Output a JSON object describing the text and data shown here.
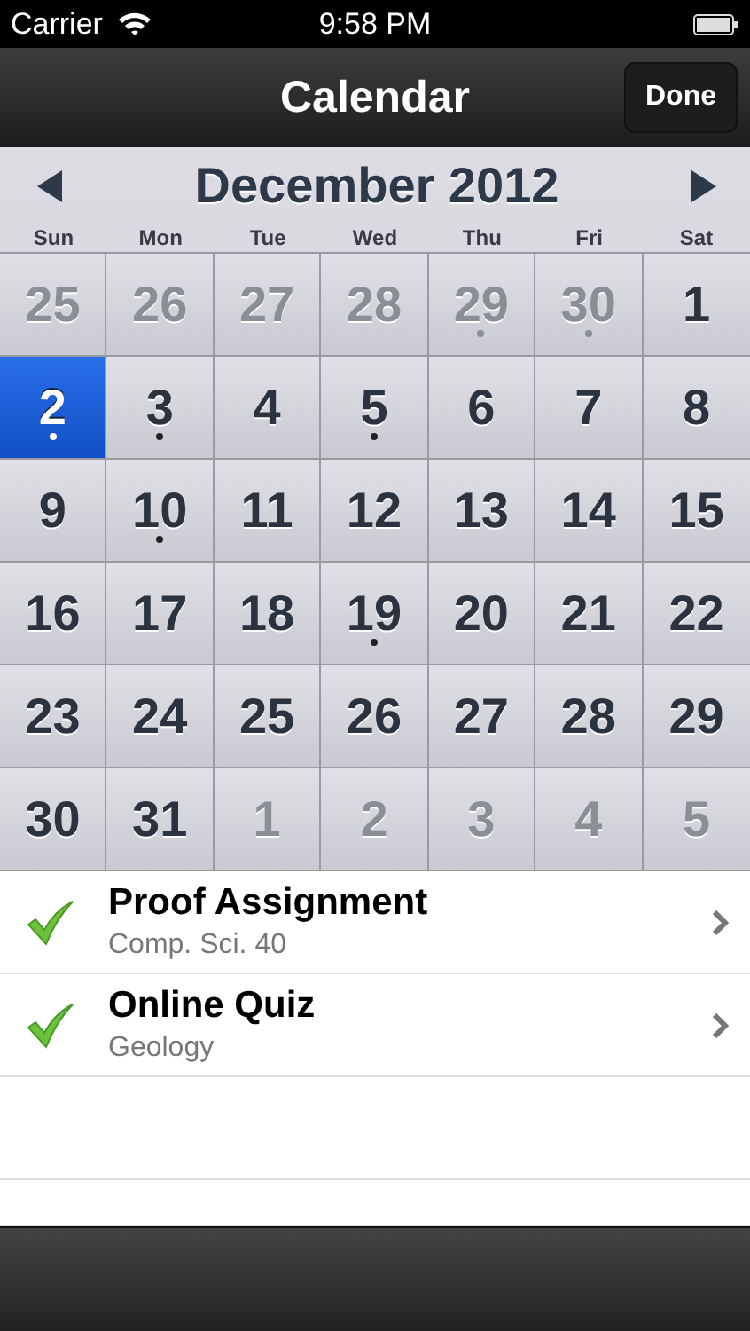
{
  "status_bar": {
    "carrier": "Carrier",
    "time": "9:58 PM"
  },
  "nav_bar": {
    "title": "Calendar",
    "done_button": "Done"
  },
  "calendar": {
    "month": "December 2012",
    "weekdays": [
      "Sun",
      "Mon",
      "Tue",
      "Wed",
      "Thu",
      "Fri",
      "Sat"
    ],
    "days": [
      {
        "day": "25",
        "in_month": false,
        "has_event": false,
        "selected": false
      },
      {
        "day": "26",
        "in_month": false,
        "has_event": false,
        "selected": false
      },
      {
        "day": "27",
        "in_month": false,
        "has_event": false,
        "selected": false
      },
      {
        "day": "28",
        "in_month": false,
        "has_event": false,
        "selected": false
      },
      {
        "day": "29",
        "in_month": false,
        "has_event": true,
        "selected": false
      },
      {
        "day": "30",
        "in_month": false,
        "has_event": true,
        "selected": false
      },
      {
        "day": "1",
        "in_month": true,
        "has_event": false,
        "selected": false
      },
      {
        "day": "2",
        "in_month": true,
        "has_event": true,
        "selected": true
      },
      {
        "day": "3",
        "in_month": true,
        "has_event": true,
        "selected": false
      },
      {
        "day": "4",
        "in_month": true,
        "has_event": false,
        "selected": false
      },
      {
        "day": "5",
        "in_month": true,
        "has_event": true,
        "selected": false
      },
      {
        "day": "6",
        "in_month": true,
        "has_event": false,
        "selected": false
      },
      {
        "day": "7",
        "in_month": true,
        "has_event": false,
        "selected": false
      },
      {
        "day": "8",
        "in_month": true,
        "has_event": false,
        "selected": false
      },
      {
        "day": "9",
        "in_month": true,
        "has_event": false,
        "selected": false
      },
      {
        "day": "10",
        "in_month": true,
        "has_event": true,
        "selected": false
      },
      {
        "day": "11",
        "in_month": true,
        "has_event": false,
        "selected": false
      },
      {
        "day": "12",
        "in_month": true,
        "has_event": false,
        "selected": false
      },
      {
        "day": "13",
        "in_month": true,
        "has_event": false,
        "selected": false
      },
      {
        "day": "14",
        "in_month": true,
        "has_event": false,
        "selected": false
      },
      {
        "day": "15",
        "in_month": true,
        "has_event": false,
        "selected": false
      },
      {
        "day": "16",
        "in_month": true,
        "has_event": false,
        "selected": false
      },
      {
        "day": "17",
        "in_month": true,
        "has_event": false,
        "selected": false
      },
      {
        "day": "18",
        "in_month": true,
        "has_event": false,
        "selected": false
      },
      {
        "day": "19",
        "in_month": true,
        "has_event": true,
        "selected": false
      },
      {
        "day": "20",
        "in_month": true,
        "has_event": false,
        "selected": false
      },
      {
        "day": "21",
        "in_month": true,
        "has_event": false,
        "selected": false
      },
      {
        "day": "22",
        "in_month": true,
        "has_event": false,
        "selected": false
      },
      {
        "day": "23",
        "in_month": true,
        "has_event": false,
        "selected": false
      },
      {
        "day": "24",
        "in_month": true,
        "has_event": false,
        "selected": false
      },
      {
        "day": "25",
        "in_month": true,
        "has_event": false,
        "selected": false
      },
      {
        "day": "26",
        "in_month": true,
        "has_event": false,
        "selected": false
      },
      {
        "day": "27",
        "in_month": true,
        "has_event": false,
        "selected": false
      },
      {
        "day": "28",
        "in_month": true,
        "has_event": false,
        "selected": false
      },
      {
        "day": "29",
        "in_month": true,
        "has_event": false,
        "selected": false
      },
      {
        "day": "30",
        "in_month": true,
        "has_event": false,
        "selected": false
      },
      {
        "day": "31",
        "in_month": true,
        "has_event": false,
        "selected": false
      },
      {
        "day": "1",
        "in_month": false,
        "has_event": false,
        "selected": false
      },
      {
        "day": "2",
        "in_month": false,
        "has_event": false,
        "selected": false
      },
      {
        "day": "3",
        "in_month": false,
        "has_event": false,
        "selected": false
      },
      {
        "day": "4",
        "in_month": false,
        "has_event": false,
        "selected": false
      },
      {
        "day": "5",
        "in_month": false,
        "has_event": false,
        "selected": false
      }
    ]
  },
  "events": [
    {
      "title": "Proof Assignment",
      "subtitle": "Comp. Sci. 40",
      "completed": true
    },
    {
      "title": "Online Quiz",
      "subtitle": "Geology",
      "completed": true
    }
  ]
}
